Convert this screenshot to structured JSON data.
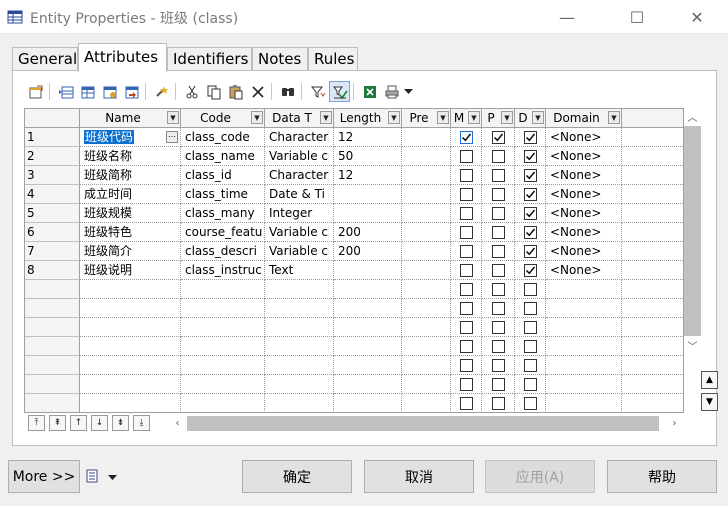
{
  "window": {
    "title": "Entity Properties - 班级 (class)",
    "minimize_glyph": "—",
    "maximize_glyph": "☐",
    "close_glyph": "✕"
  },
  "tabs": [
    {
      "label": "General"
    },
    {
      "label": "Attributes",
      "active": true
    },
    {
      "label": "Identifiers"
    },
    {
      "label": "Notes"
    },
    {
      "label": "Rules"
    }
  ],
  "toolbar": {
    "icons": [
      "properties-icon",
      "insert-row-icon",
      "add-row-icon",
      "add-attributes-icon",
      "reuse-attributes-icon",
      "new-icon",
      "cut-icon",
      "copy-icon",
      "paste-icon",
      "delete-icon",
      "find-icon",
      "filter-icon",
      "customize-columns-icon",
      "excel-export-icon",
      "print-icon",
      "dropdown-arrow-icon"
    ]
  },
  "grid": {
    "columns": [
      "Name",
      "Code",
      "Data T",
      "Length",
      "Pre",
      "M",
      "P",
      "D",
      "Domain"
    ],
    "rows": [
      {
        "num": "1",
        "name": "班级代码",
        "code": "class_code",
        "type": "Character",
        "length": "12",
        "m": true,
        "p": true,
        "d": true,
        "domain": "<None>",
        "selected": true
      },
      {
        "num": "2",
        "name": "班级名称",
        "code": "class_name",
        "type": "Variable c",
        "length": "50",
        "m": false,
        "p": false,
        "d": true,
        "domain": "<None>"
      },
      {
        "num": "3",
        "name": "班级简称",
        "code": "class_id",
        "type": "Character",
        "length": "12",
        "m": false,
        "p": false,
        "d": true,
        "domain": "<None>"
      },
      {
        "num": "4",
        "name": "成立时间",
        "code": "class_time",
        "type": "Date & Ti",
        "length": "",
        "m": false,
        "p": false,
        "d": true,
        "domain": "<None>"
      },
      {
        "num": "5",
        "name": "班级规模",
        "code": "class_many",
        "type": "Integer",
        "length": "",
        "m": false,
        "p": false,
        "d": true,
        "domain": "<None>"
      },
      {
        "num": "6",
        "name": "班级特色",
        "code": "course_featu",
        "type": "Variable c",
        "length": "200",
        "m": false,
        "p": false,
        "d": true,
        "domain": "<None>"
      },
      {
        "num": "7",
        "name": "班级简介",
        "code": "class_descri",
        "type": "Variable c",
        "length": "200",
        "m": false,
        "p": false,
        "d": true,
        "domain": "<None>"
      },
      {
        "num": "8",
        "name": "班级说明",
        "code": "class_instruc",
        "type": "Text",
        "length": "",
        "m": false,
        "p": false,
        "d": true,
        "domain": "<None>"
      }
    ],
    "empty_rows": 7
  },
  "navigation": {
    "icons": [
      "move-top-icon",
      "move-page-up-icon",
      "move-up-icon",
      "move-down-icon",
      "move-page-down-icon",
      "move-bottom-icon"
    ]
  },
  "buttons": {
    "more": "More >>",
    "ok": "确定",
    "cancel": "取消",
    "apply": "应用(A)",
    "help": "帮助"
  }
}
